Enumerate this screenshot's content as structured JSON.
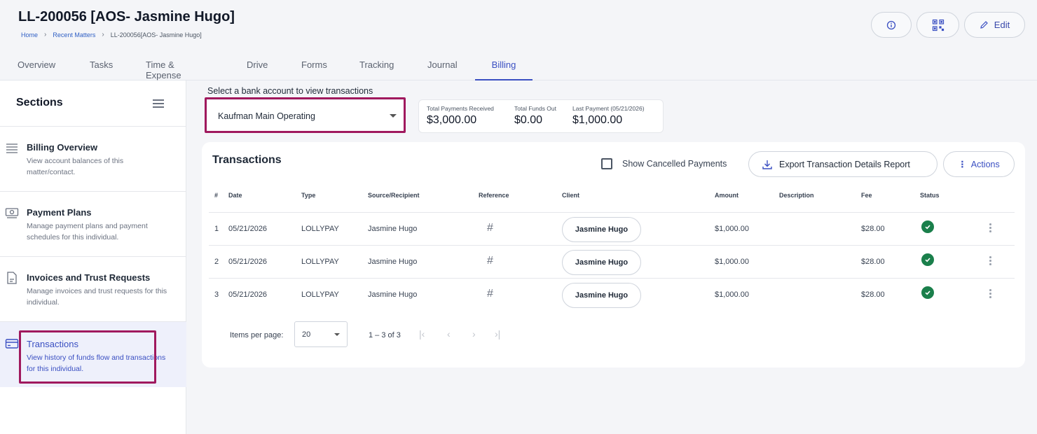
{
  "header": {
    "title": "LL-200056 [AOS- Jasmine Hugo]",
    "breadcrumb": [
      "Home",
      "Recent Matters",
      "LL-200056[AOS- Jasmine Hugo]"
    ],
    "edit_label": "Edit"
  },
  "tabs": [
    "Overview",
    "Tasks",
    "Time & Expense",
    "Drive",
    "Forms",
    "Tracking",
    "Journal",
    "Billing"
  ],
  "active_tab": "Billing",
  "sidebar": {
    "title": "Sections",
    "items": [
      {
        "title": "Billing Overview",
        "desc": "View account balances of this matter/contact.",
        "icon": "list-icon"
      },
      {
        "title": "Payment Plans",
        "desc": "Manage payment plans and payment schedules for this individual.",
        "icon": "money-icon"
      },
      {
        "title": "Invoices and Trust Requests",
        "desc": "Manage invoices and trust requests for this individual.",
        "icon": "document-icon"
      },
      {
        "title": "Transactions",
        "desc": "View history of funds flow and transactions for this individual.",
        "icon": "card-icon"
      }
    ],
    "active_item": "Transactions"
  },
  "bank": {
    "label": "Select a bank account to view transactions",
    "selected": "Kaufman Main Operating"
  },
  "summary": {
    "received_label": "Total Payments Received",
    "received_value": "$3,000.00",
    "out_label": "Total Funds Out",
    "out_value": "$0.00",
    "last_label": "Last Payment (05/21/2026)",
    "last_value": "$1,000.00"
  },
  "transactions": {
    "title": "Transactions",
    "show_cancelled_label": "Show Cancelled Payments",
    "export_label": "Export Transaction Details Report",
    "actions_label": "Actions",
    "columns": [
      "#",
      "Date",
      "Type",
      "Source/Recipient",
      "Reference",
      "Client",
      "Amount",
      "Description",
      "Fee",
      "Status"
    ],
    "rows": [
      {
        "num": "1",
        "date": "05/21/2026",
        "type": "LOLLYPAY",
        "source": "Jasmine Hugo",
        "reference": "#",
        "client": "Jasmine Hugo",
        "amount": "$1,000.00",
        "description": "",
        "fee": "$28.00",
        "status": "success"
      },
      {
        "num": "2",
        "date": "05/21/2026",
        "type": "LOLLYPAY",
        "source": "Jasmine Hugo",
        "reference": "#",
        "client": "Jasmine Hugo",
        "amount": "$1,000.00",
        "description": "",
        "fee": "$28.00",
        "status": "success"
      },
      {
        "num": "3",
        "date": "05/21/2026",
        "type": "LOLLYPAY",
        "source": "Jasmine Hugo",
        "reference": "#",
        "client": "Jasmine Hugo",
        "amount": "$1,000.00",
        "description": "",
        "fee": "$28.00",
        "status": "success"
      }
    ],
    "pager": {
      "items_label": "Items per page:",
      "items_value": "20",
      "range": "1 – 3 of 3"
    }
  },
  "colors": {
    "accent": "#3a4fc2",
    "highlight": "#a0195e",
    "success": "#1a7f4b"
  }
}
